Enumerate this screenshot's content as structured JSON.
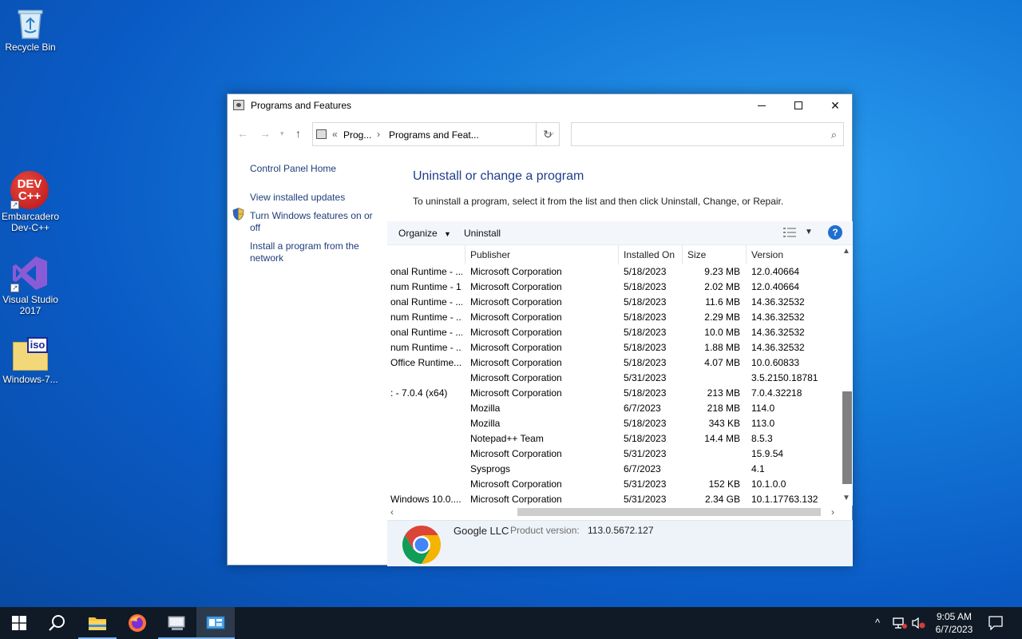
{
  "desktop": {
    "icons": [
      {
        "label": "Recycle Bin"
      },
      {
        "label": "Embarcadero Dev-C++"
      },
      {
        "label": "Visual Studio 2017"
      },
      {
        "label": "Windows-7..."
      }
    ],
    "devcpp_logo_text": "DEV C++",
    "iso_text": "iso"
  },
  "window": {
    "title": "Programs and Features",
    "address": {
      "breadcrumb_1": "Prog...",
      "breadcrumb_2": "Programs and Feat...",
      "overflow": "«"
    },
    "search": {
      "placeholder": "",
      "value": ""
    },
    "sidebar": {
      "home": "Control Panel Home",
      "links": [
        "View installed updates",
        "Turn Windows features on or off",
        "Install a program from the network"
      ]
    },
    "heading": "Uninstall or change a program",
    "subtext": "To uninstall a program, select it from the list and then click Uninstall, Change, or Repair.",
    "toolbar": {
      "organize": "Organize",
      "uninstall": "Uninstall",
      "help": "?"
    },
    "columns": {
      "publisher": "Publisher",
      "installed_on": "Installed On",
      "size": "Size",
      "version": "Version"
    },
    "rows": [
      {
        "name": "onal Runtime - ...",
        "publisher": "Microsoft Corporation",
        "installed": "5/18/2023",
        "size": "9.23 MB",
        "version": "12.0.40664"
      },
      {
        "name": "num Runtime - 1...",
        "publisher": "Microsoft Corporation",
        "installed": "5/18/2023",
        "size": "2.02 MB",
        "version": "12.0.40664"
      },
      {
        "name": "onal Runtime - ...",
        "publisher": "Microsoft Corporation",
        "installed": "5/18/2023",
        "size": "11.6 MB",
        "version": "14.36.32532"
      },
      {
        "name": "num Runtime - ...",
        "publisher": "Microsoft Corporation",
        "installed": "5/18/2023",
        "size": "2.29 MB",
        "version": "14.36.32532"
      },
      {
        "name": "onal Runtime - ...",
        "publisher": "Microsoft Corporation",
        "installed": "5/18/2023",
        "size": "10.0 MB",
        "version": "14.36.32532"
      },
      {
        "name": "num Runtime - ...",
        "publisher": "Microsoft Corporation",
        "installed": "5/18/2023",
        "size": "1.88 MB",
        "version": "14.36.32532"
      },
      {
        "name": "Office Runtime...",
        "publisher": "Microsoft Corporation",
        "installed": "5/18/2023",
        "size": "4.07 MB",
        "version": "10.0.60833"
      },
      {
        "name": "",
        "publisher": "Microsoft Corporation",
        "installed": "5/31/2023",
        "size": "",
        "version": "3.5.2150.18781"
      },
      {
        "name": ": - 7.0.4 (x64)",
        "publisher": "Microsoft Corporation",
        "installed": "5/18/2023",
        "size": "213 MB",
        "version": "7.0.4.32218"
      },
      {
        "name": "",
        "publisher": "Mozilla",
        "installed": "6/7/2023",
        "size": "218 MB",
        "version": "114.0"
      },
      {
        "name": "",
        "publisher": "Mozilla",
        "installed": "5/18/2023",
        "size": "343 KB",
        "version": "113.0"
      },
      {
        "name": "",
        "publisher": "Notepad++ Team",
        "installed": "5/18/2023",
        "size": "14.4 MB",
        "version": "8.5.3"
      },
      {
        "name": "",
        "publisher": "Microsoft Corporation",
        "installed": "5/31/2023",
        "size": "",
        "version": "15.9.54"
      },
      {
        "name": "",
        "publisher": "Sysprogs",
        "installed": "6/7/2023",
        "size": "",
        "version": "4.1"
      },
      {
        "name": "",
        "publisher": "Microsoft Corporation",
        "installed": "5/31/2023",
        "size": "152 KB",
        "version": "10.1.0.0"
      },
      {
        "name": "Windows 10.0....",
        "publisher": "Microsoft Corporation",
        "installed": "5/31/2023",
        "size": "2.34 GB",
        "version": "10.1.17763.132"
      }
    ],
    "details": {
      "publisher": "Google LLC",
      "product_version_label": "Product version:",
      "product_version": "113.0.5672.127"
    }
  },
  "taskbar": {
    "clock_time": "9:05 AM",
    "clock_date": "6/7/2023"
  }
}
